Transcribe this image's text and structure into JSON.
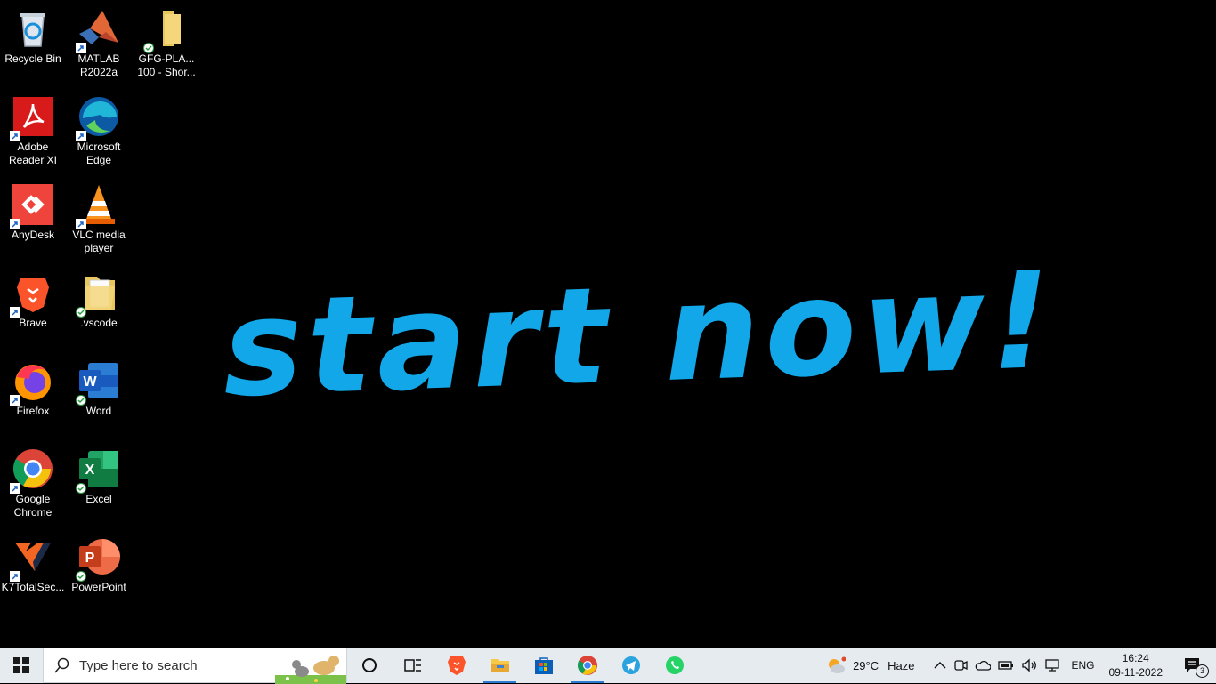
{
  "desktop_icons": [
    {
      "label": "Recycle Bin",
      "icon": "recycle-bin-icon"
    },
    {
      "label": "MATLAB R2022a",
      "icon": "matlab-icon"
    },
    {
      "label": "GFG-PLA... 100 - Shor...",
      "icon": "folder-icon"
    },
    {
      "label": "Adobe Reader XI",
      "icon": "adobe-reader-icon"
    },
    {
      "label": "Microsoft Edge",
      "icon": "edge-icon"
    },
    {
      "label": "AnyDesk",
      "icon": "anydesk-icon"
    },
    {
      "label": "VLC media player",
      "icon": "vlc-icon"
    },
    {
      "label": "Brave",
      "icon": "brave-icon"
    },
    {
      "label": ".vscode",
      "icon": "vscode-folder-icon"
    },
    {
      "label": "Firefox",
      "icon": "firefox-icon"
    },
    {
      "label": "Word",
      "icon": "word-icon"
    },
    {
      "label": "Google Chrome",
      "icon": "chrome-icon"
    },
    {
      "label": "Excel",
      "icon": "excel-icon"
    },
    {
      "label": "K7TotalSec...",
      "icon": "k7-icon"
    },
    {
      "label": "PowerPoint",
      "icon": "powerpoint-icon"
    }
  ],
  "wallpaper": {
    "text": "start now!",
    "color": "#12a7e8"
  },
  "taskbar": {
    "search_placeholder": "Type here to search",
    "weather": {
      "temp": "29°C",
      "condition": "Haze"
    },
    "language": "ENG",
    "time": "16:24",
    "date": "09-11-2022",
    "notification_count": "3",
    "apps": [
      "cortana-icon",
      "task-view-icon",
      "brave-icon",
      "file-explorer-icon",
      "microsoft-store-icon",
      "chrome-icon",
      "telegram-icon",
      "whatsapp-icon"
    ]
  }
}
